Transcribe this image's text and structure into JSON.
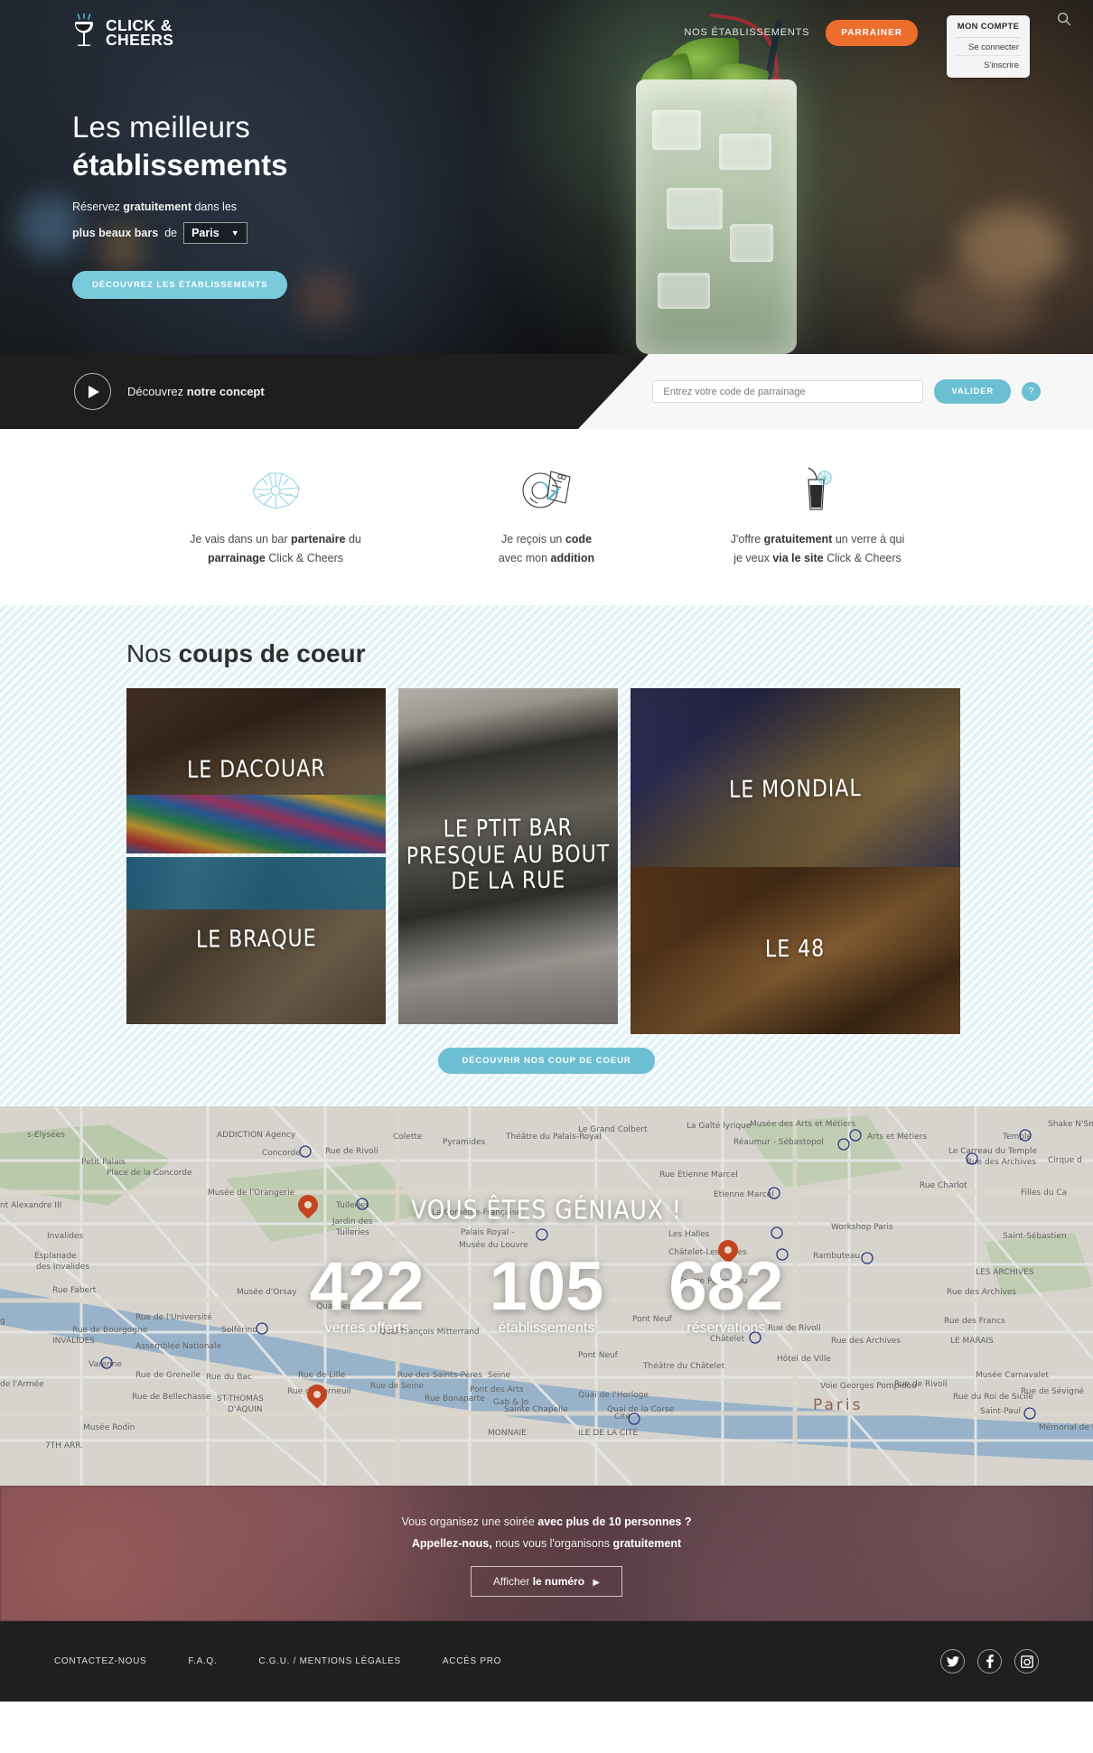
{
  "brand": {
    "name_line1": "CLICK &",
    "name_line2": "CHEERS",
    "logo_icon": "cocktail-glass-icon"
  },
  "header": {
    "nav_establishments": "NOS ÉTABLISSEMENTS",
    "sponsor_button": "PARRAINER",
    "search_icon": "search-icon",
    "account": {
      "title": "MON COMPTE",
      "login": "Se connecter",
      "register": "S'inscrire"
    }
  },
  "hero": {
    "title_light": "Les meilleurs",
    "title_bold": "établissements",
    "sub_line1_a": "Réservez ",
    "sub_line1_b": "gratuitement",
    "sub_line1_c": " dans les",
    "sub_line2_bold": "plus beaux bars",
    "sub_line2_rest": "de",
    "city_value": "Paris",
    "city_caret": "▼",
    "cta": "DÉCOUVREZ LES ÉTABLISSEMENTS"
  },
  "concept": {
    "play_icon": "play-icon",
    "text_a": "Découvrez ",
    "text_b": "notre concept",
    "code_placeholder": "Entrez votre code de parrainage",
    "validate": "VALIDER",
    "help": "?"
  },
  "steps": [
    {
      "icon": "paris-map-icon",
      "line1_a": "Je vais dans un bar ",
      "line1_b": "partenaire",
      "line1_c": " du",
      "line2_a": "",
      "line2_b": "parrainage",
      "line2_c": " Click & Cheers"
    },
    {
      "icon": "receipt-bill-icon",
      "line1_a": "Je reçois un ",
      "line1_b": "code",
      "line1_c": "",
      "line2_a": "avec mon ",
      "line2_b": "addition",
      "line2_c": ""
    },
    {
      "icon": "cocktail-drink-icon",
      "line1_a": "J'offre ",
      "line1_b": "gratuitement",
      "line1_c": " un verre à qui",
      "line2_a": "je veux ",
      "line2_b": "via le site",
      "line2_c": " Click & Cheers"
    }
  ],
  "favorites": {
    "title_light": "Nos ",
    "title_bold": "coups de coeur",
    "cards": [
      {
        "name": "LE DACOUAR",
        "size": "22px"
      },
      {
        "name": "LE BRAQUE",
        "size": "22px"
      },
      {
        "name": "LE PTIT BAR PRESQUE AU BOUT DE LA RUE",
        "size": "22px"
      },
      {
        "name": "LE MONDIAL",
        "size": "22px"
      },
      {
        "name": "LE 48",
        "size": "22px"
      }
    ],
    "cta": "DÉCOUVRIR NOS COUP DE COEUR"
  },
  "stats": {
    "heading": "VOUS ÊTES GÉNIAUX !",
    "items": [
      {
        "value": "422",
        "label": "verres offerts"
      },
      {
        "value": "105",
        "label": "établissements"
      },
      {
        "value": "682",
        "label": "réservations"
      }
    ],
    "map_city_label": "Paris"
  },
  "cta": {
    "line1_a": "Vous organisez une soirée ",
    "line1_b": "avec plus de 10 personnes ?",
    "line2_a": "Appellez-nous,",
    "line2_b": " nous vous l'organisons ",
    "line2_c": "gratuitement",
    "button_a": "Afficher ",
    "button_b": "le numéro",
    "button_arrow": "▶"
  },
  "footer": {
    "links": [
      "CONTACTEZ-NOUS",
      "F.A.Q.",
      "C.G.U. / MENTIONS LÉGALES",
      "ACCÈS PRO"
    ],
    "socials": [
      "twitter-icon",
      "facebook-icon",
      "instagram-icon"
    ]
  },
  "colors": {
    "orange": "#ed6d2d",
    "cyan": "#6cbfd3",
    "dark": "#1e1e1e",
    "footer": "#1f1f1f"
  }
}
